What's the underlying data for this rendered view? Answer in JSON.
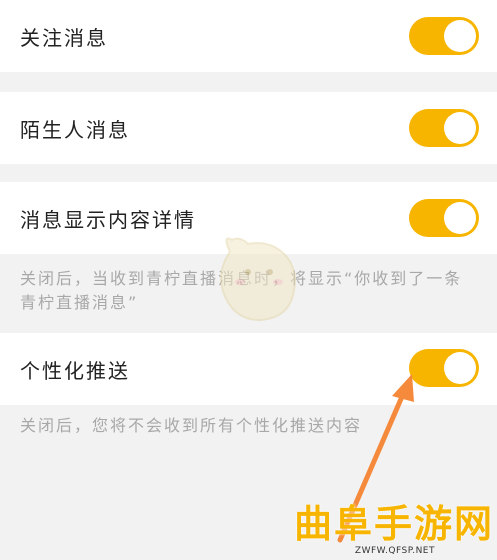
{
  "settings": [
    {
      "label": "关注消息",
      "enabled": true
    },
    {
      "label": "陌生人消息",
      "enabled": true
    },
    {
      "label": "消息显示内容详情",
      "enabled": true,
      "hint_line1": "关闭后，当收到青柠直播消息时，将显示“你收到了一条",
      "hint_line2": "青柠直播消息”"
    },
    {
      "label": "个性化推送",
      "enabled": true,
      "hint_line1": "关闭后，您将不会收到所有个性化推送内容"
    }
  ],
  "watermark": {
    "text": "曲阜手游网",
    "url": "ZWFW.QFSP.NET"
  },
  "colors": {
    "accent": "#f7b500",
    "arrow": "#f58a3c",
    "background": "#f2f2f2"
  }
}
